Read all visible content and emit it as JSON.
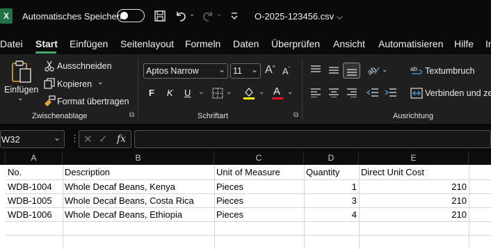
{
  "title": {
    "app_icon": "X",
    "autosave_label": "Automatisches Speichern",
    "filename": "O-2025-123456.csv"
  },
  "menu": [
    "Datei",
    "Start",
    "Einfügen",
    "Seitenlayout",
    "Formeln",
    "Daten",
    "Überprüfen",
    "Ansicht",
    "Automatisieren",
    "Hilfe",
    "In"
  ],
  "ribbon": {
    "clipboard": {
      "paste_label": "Einfügen",
      "cut_label": "Ausschneiden",
      "copy_label": "Kopieren",
      "format_painter_label": "Format übertragen",
      "group_label": "Zwischenablage"
    },
    "font": {
      "font_name": "Aptos Narrow",
      "font_size": "11",
      "bold": "F",
      "italic": "K",
      "underline": "U",
      "group_label": "Schriftart"
    },
    "alignment": {
      "wrap_label": "Textumbruch",
      "merge_label": "Verbinden und zen",
      "group_label": "Ausrichtung"
    }
  },
  "formula_bar": {
    "name_box": "W32",
    "fx": "fx",
    "formula": ""
  },
  "sheet": {
    "columns": [
      "A",
      "B",
      "C",
      "D",
      "E"
    ],
    "header_row": [
      "No.",
      "Description",
      "Unit of Measure",
      "Quantity",
      "Direct Unit Cost"
    ],
    "rows": [
      [
        "WDB-1004",
        "Whole Decaf Beans, Kenya",
        "Pieces",
        "1",
        "210"
      ],
      [
        "WDB-1005",
        "Whole Decaf Beans, Costa Rica",
        "Pieces",
        "3",
        "210"
      ],
      [
        "WDB-1006",
        "Whole Decaf Beans, Ethiopia",
        "Pieces",
        "4",
        "210"
      ]
    ]
  },
  "colors": {
    "accent": "#217346",
    "underline_red": "#e81123",
    "highlight_yellow": "#ffff00"
  }
}
